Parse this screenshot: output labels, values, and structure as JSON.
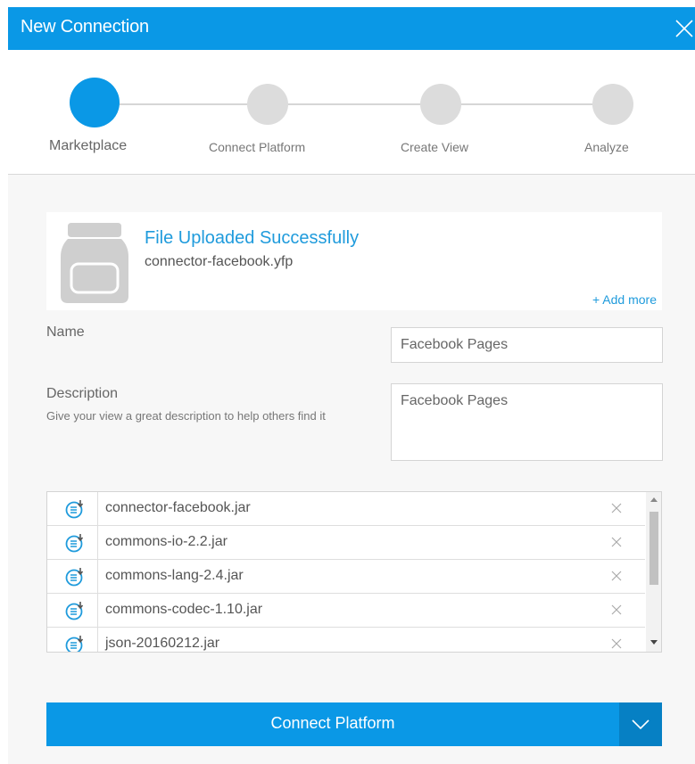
{
  "dialog": {
    "title": "New Connection"
  },
  "steps": [
    {
      "label": "Marketplace",
      "active": true
    },
    {
      "label": "Connect Platform",
      "active": false
    },
    {
      "label": "Create View",
      "active": false
    },
    {
      "label": "Analyze",
      "active": false
    }
  ],
  "upload": {
    "status": "File Uploaded Successfully",
    "filename": "connector-facebook.yfp",
    "add_more": "+ Add more"
  },
  "form": {
    "name_label": "Name",
    "name_value": "Facebook Pages",
    "description_label": "Description",
    "description_hint": "Give your view a great description to help others find it",
    "description_value": "Facebook Pages"
  },
  "files": [
    {
      "name": "connector-facebook.jar"
    },
    {
      "name": "commons-io-2.2.jar"
    },
    {
      "name": "commons-lang-2.4.jar"
    },
    {
      "name": "commons-codec-1.10.jar"
    },
    {
      "name": "json-20160212.jar"
    }
  ],
  "actions": {
    "connect_label": "Connect Platform"
  },
  "colors": {
    "accent": "#0a98e6",
    "accent_dark": "#0680c4",
    "link": "#1f9bdc"
  }
}
